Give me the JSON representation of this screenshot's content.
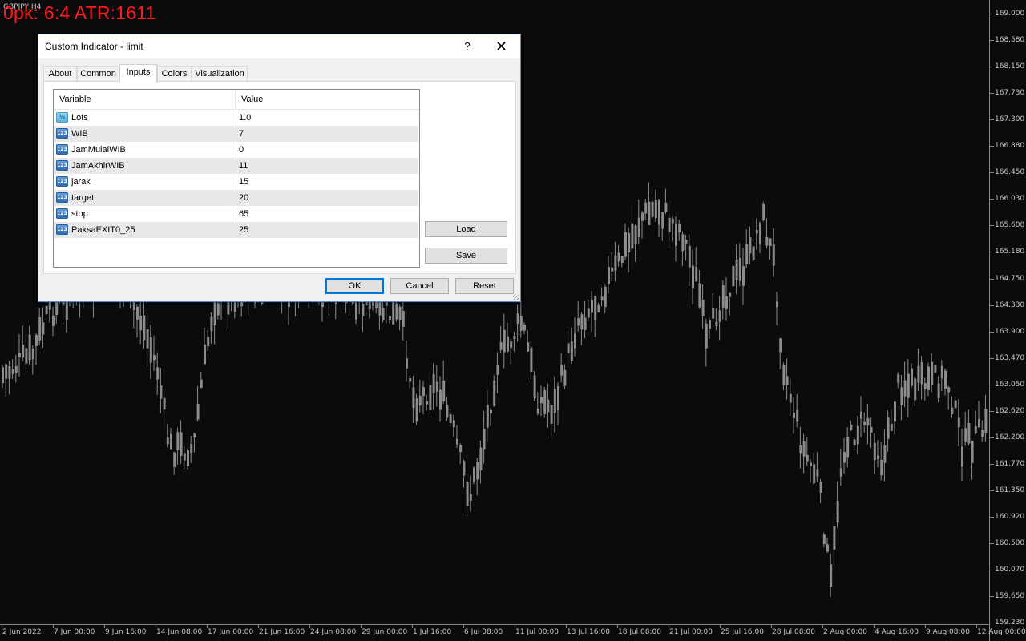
{
  "chart": {
    "symbol": "GBPJPY,H4",
    "overlay_text": "0pk: 6:4 ATR:1611",
    "candle_color": "#8c8c8c",
    "background": "#0b0b0e",
    "price_labels": [
      "169.000",
      "168.580",
      "168.150",
      "167.730",
      "167.300",
      "166.880",
      "166.450",
      "166.030",
      "165.600",
      "165.180",
      "164.750",
      "164.330",
      "163.900",
      "163.470",
      "163.050",
      "162.620",
      "162.200",
      "161.770",
      "161.350",
      "160.920",
      "160.500",
      "160.070",
      "159.650",
      "159.230"
    ],
    "time_labels": [
      "2 Jun 2022",
      "7 Jun 00:00",
      "9 Jun 16:00",
      "14 Jun 08:00",
      "17 Jun 00:00",
      "21 Jun 16:00",
      "24 Jun 08:00",
      "29 Jun 00:00",
      "1 Jul 16:00",
      "6 Jul 08:00",
      "11 Jul 00:00",
      "13 Jul 16:00",
      "18 Jul 08:00",
      "21 Jul 00:00",
      "25 Jul 16:00",
      "28 Jul 08:00",
      "2 Aug 00:00",
      "4 Aug 16:00",
      "9 Aug 08:00",
      "12 Aug 00:00"
    ]
  },
  "dialog": {
    "title": "Custom Indicator - limit",
    "help_label": "?",
    "close_label": "✕",
    "tabs": [
      {
        "label": "About"
      },
      {
        "label": "Common"
      },
      {
        "label": "Inputs",
        "active": true
      },
      {
        "label": "Colors"
      },
      {
        "label": "Visualization"
      }
    ],
    "table": {
      "header_variable": "Variable",
      "header_value": "Value",
      "rows": [
        {
          "name": "Lots",
          "value": "1.0",
          "icon": "double-type-icon"
        },
        {
          "name": "WIB",
          "value": "7",
          "icon": "int-type-icon"
        },
        {
          "name": "JamMulaiWIB",
          "value": "0",
          "icon": "int-type-icon"
        },
        {
          "name": "JamAkhirWIB",
          "value": "11",
          "icon": "int-type-icon"
        },
        {
          "name": "jarak",
          "value": "15",
          "icon": "int-type-icon"
        },
        {
          "name": "target",
          "value": "20",
          "icon": "int-type-icon"
        },
        {
          "name": "stop",
          "value": "65",
          "icon": "int-type-icon"
        },
        {
          "name": "PaksaEXIT0_25",
          "value": "25",
          "icon": "int-type-icon"
        }
      ]
    },
    "buttons": {
      "load": "Load",
      "save": "Save",
      "ok": "OK",
      "cancel": "Cancel",
      "reset": "Reset"
    }
  }
}
